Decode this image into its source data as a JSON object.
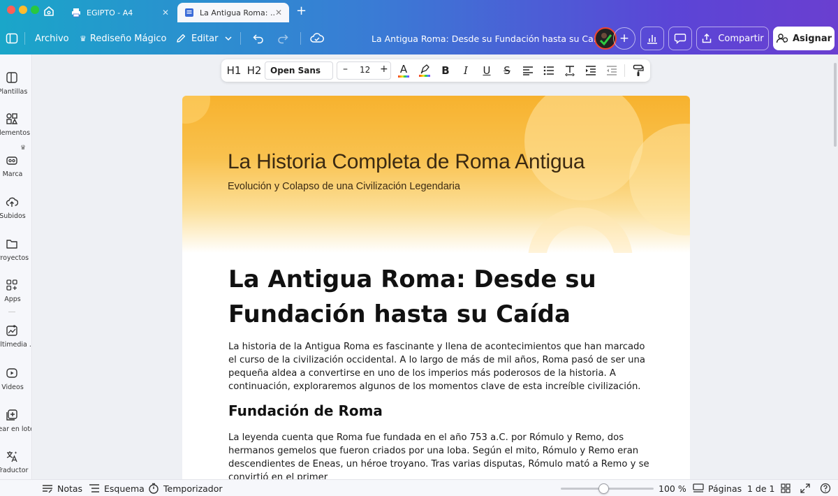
{
  "tabs": {
    "home_icon": "home-icon",
    "items": [
      {
        "label": "EGIPTO - A4",
        "icon": "printer-icon"
      },
      {
        "label": "La Antigua Roma: ...",
        "icon": "document-icon"
      }
    ],
    "new_tab": "+"
  },
  "toolbar": {
    "file": "Archivo",
    "magic": "Rediseño Mágico",
    "edit": "Editar",
    "doc_title": "La Antigua Roma: Desde su Fundación hasta su Caída",
    "add": "+",
    "share": "Compartir",
    "assign": "Asignar"
  },
  "sidebar": {
    "items": [
      {
        "label": "Plantillas",
        "icon": "templates-icon"
      },
      {
        "label": "Elementos",
        "icon": "elements-icon"
      },
      {
        "label": "Marca",
        "icon": "brand-icon"
      },
      {
        "label": "Subidos",
        "icon": "upload-icon"
      },
      {
        "label": "Proyectos",
        "icon": "folder-icon"
      },
      {
        "label": "Apps",
        "icon": "apps-icon"
      },
      {
        "label": "Multimedia ...",
        "icon": "multimedia-icon"
      },
      {
        "label": "Videos",
        "icon": "video-icon"
      },
      {
        "label": "Crear en lote",
        "icon": "bulk-create-icon"
      },
      {
        "label": "Traductor",
        "icon": "translate-icon"
      }
    ]
  },
  "format": {
    "h1": "H1",
    "h2": "H2",
    "font": "Open Sans",
    "minus": "–",
    "size": "12",
    "plus": "+",
    "text_color": "A",
    "bold": "B",
    "italic": "I",
    "underline": "U",
    "strike": "S"
  },
  "page": {
    "banner_title": "La Historia Completa de Roma Antigua",
    "banner_subtitle": "Evolución y Colapso de una Civilización Legendaria",
    "heading": "La Antigua Roma: Desde su Fundación hasta su Caída",
    "intro": "La historia de la Antigua Roma es fascinante y llena de acontecimientos que han marcado el curso de la civilización occidental. A lo largo de más de mil años, Roma pasó de ser una pequeña aldea a convertirse en uno de los imperios más poderosos de la historia. A continuación, exploraremos algunos de los momentos clave de esta increíble civilización.",
    "section_title": "Fundación de Roma",
    "section_text": "La leyenda cuenta que Roma fue fundada en el año 753 a.C. por Rómulo y Remo, dos hermanos gemelos que fueron criados por una loba. Según el mito, Rómulo y Remo eran descendientes de Eneas, un héroe troyano. Tras varias disputas, Rómulo mató a Remo y se convirtió en el primer"
  },
  "statusbar": {
    "notes": "Notas",
    "outline": "Esquema",
    "timer": "Temporizador",
    "zoom": "100 %",
    "zoom_fraction": 0.46,
    "pages": "Páginas",
    "page_count": "1 de 1"
  },
  "colors": {
    "gradient_start": "#1aa6c9",
    "gradient_end": "#6a3fd0",
    "banner_orange": "#f7b22e"
  }
}
